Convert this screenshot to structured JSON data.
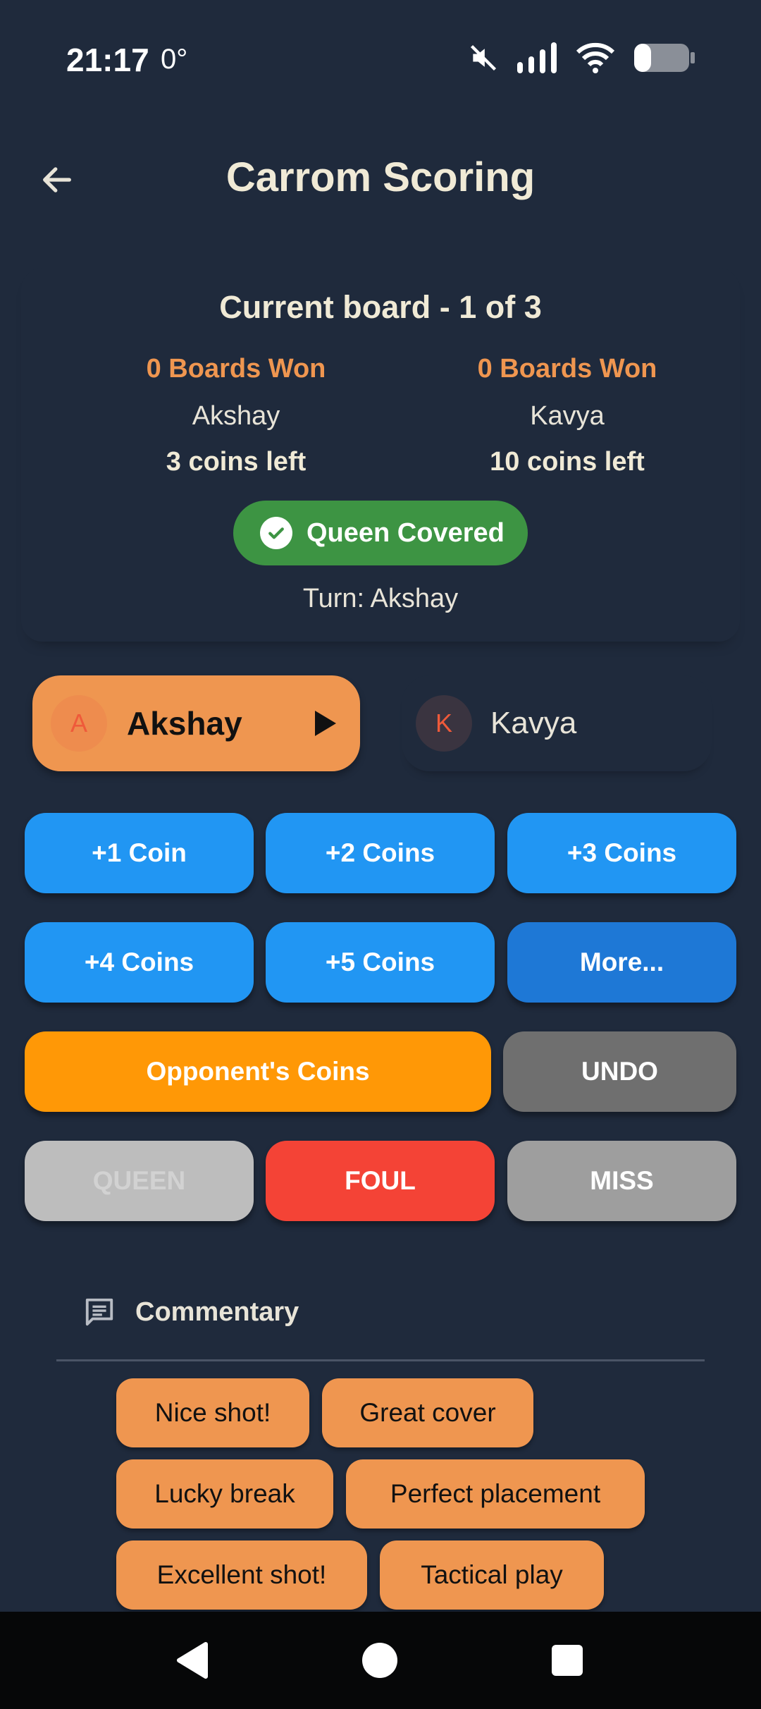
{
  "status_bar": {
    "time": "21:17",
    "temperature": "0°",
    "icons": [
      "mute-icon",
      "signal-icon",
      "wifi-icon",
      "battery-icon"
    ]
  },
  "app_bar": {
    "title": "Carrom Scoring",
    "back_icon": "back-arrow-icon"
  },
  "board": {
    "title": "Current board - 1 of 3",
    "players": [
      {
        "boards_won": "0 Boards Won",
        "name": "Akshay",
        "coins_left": "3 coins left"
      },
      {
        "boards_won": "0 Boards Won",
        "name": "Kavya",
        "coins_left": "10 coins left"
      }
    ],
    "queen_status": "Queen Covered",
    "turn": "Turn: Akshay"
  },
  "player_tabs": [
    {
      "initial": "A",
      "name": "Akshay",
      "active": true
    },
    {
      "initial": "K",
      "name": "Kavya",
      "active": false
    }
  ],
  "actions": {
    "coin1": "+1 Coin",
    "coin2": "+2 Coins",
    "coin3": "+3 Coins",
    "coin4": "+4 Coins",
    "coin5": "+5 Coins",
    "more": "More...",
    "opponent": "Opponent's Coins",
    "undo": "UNDO",
    "queen": "QUEEN",
    "foul": "FOUL",
    "miss": "MISS"
  },
  "commentary": {
    "title": "Commentary",
    "chips": [
      "Nice shot!",
      "Great cover",
      "Lucky break",
      "Perfect placement",
      "Excellent shot!",
      "Tactical play"
    ]
  },
  "colors": {
    "background": "#1f2a3c",
    "accent_orange": "#ef9650",
    "primary_blue": "#2196f3",
    "success_green": "#3d9443",
    "foul_red": "#f44336"
  }
}
